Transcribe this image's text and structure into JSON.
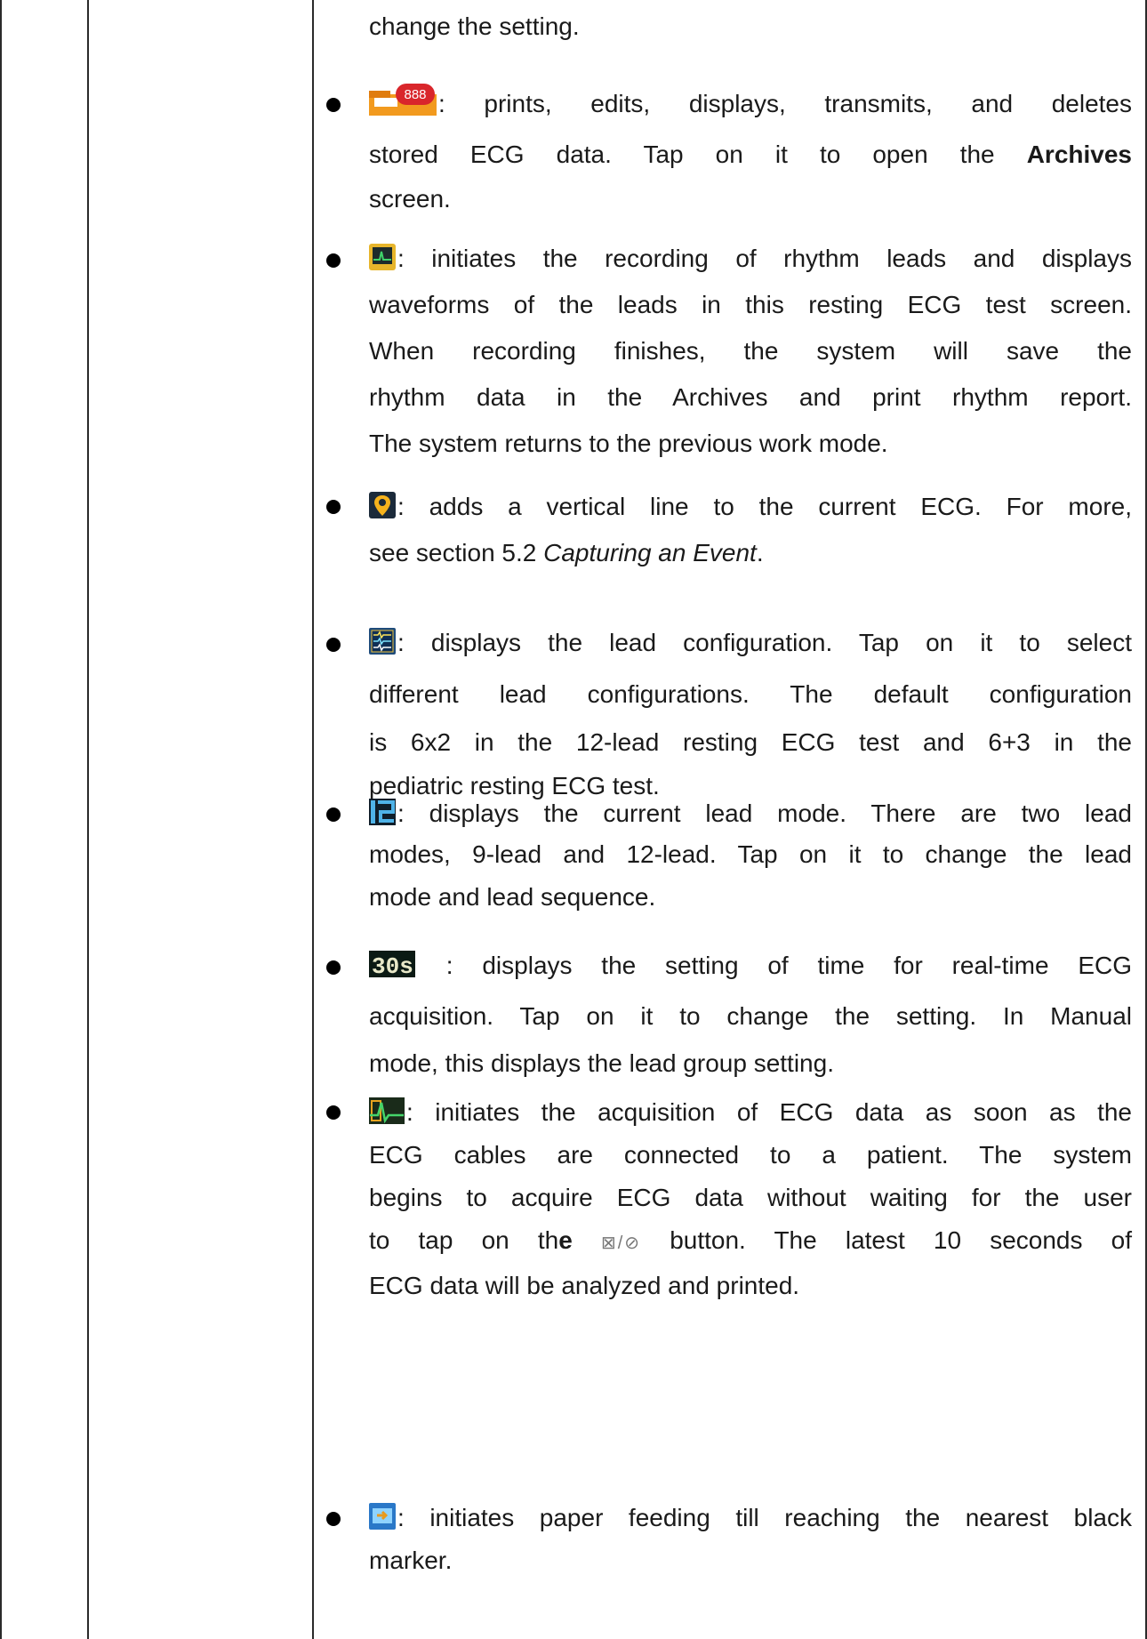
{
  "intro_line": "change the setting.",
  "items": [
    {
      "icon": "archives-folder-icon",
      "icon_badge": "888",
      "lines": [
        ": prints, edits, displays, transmits, and deletes",
        "stored ECG data. Tap on it to open the ",
        "Archives",
        "screen."
      ]
    },
    {
      "icon": "rhythm-record-icon",
      "lines": [
        ": initiates the recording of rhythm leads and displays",
        "waveforms of the leads in this resting ECG test screen.",
        "When recording finishes, the system will save the",
        "rhythm data in the Archives and print rhythm report.",
        "The system returns to the previous work mode."
      ]
    },
    {
      "icon": "event-marker-icon",
      "lines": [
        ": adds a vertical line to the current ECG. For more,",
        "see section 5.2 ",
        "Capturing an Event",
        "."
      ]
    },
    {
      "icon": "lead-configuration-icon",
      "lines": [
        ": displays the lead configuration. Tap on it to select",
        "different lead configurations. The default configuration",
        "is 6x2 in the 12-lead resting ECG test and 6+3 in the",
        "pediatric resting ECG test."
      ]
    },
    {
      "icon": "lead-mode-icon",
      "lines": [
        ": displays the current lead mode. There are two lead",
        "modes, 9-lead and 12-lead. Tap on it to change the lead",
        "mode and lead sequence."
      ]
    },
    {
      "icon": "acquisition-time-icon",
      "icon_text": "30s",
      "lines": [
        " : displays the setting of time for real-time ECG",
        "acquisition. Tap on it to change the setting. In Manual",
        "mode, this displays the lead group setting."
      ]
    },
    {
      "icon": "auto-acquisition-icon",
      "lines": [
        ": initiates the acquisition of ECG data as soon as the",
        "ECG cables are connected to a patient. The system",
        "begins to acquire ECG data without waiting for the user",
        "to tap on th",
        "e",
        "button. The latest 10 seconds of",
        "ECG data will be analyzed and printed."
      ]
    },
    {
      "icon": "paper-feed-icon",
      "lines": [
        ": initiates paper feeding till reaching the nearest black",
        "marker."
      ]
    }
  ],
  "colors": {
    "rule": "#2a2a2a",
    "text": "#1a1a1a",
    "badge": "#d9262b",
    "folder": "#f29a1e"
  }
}
